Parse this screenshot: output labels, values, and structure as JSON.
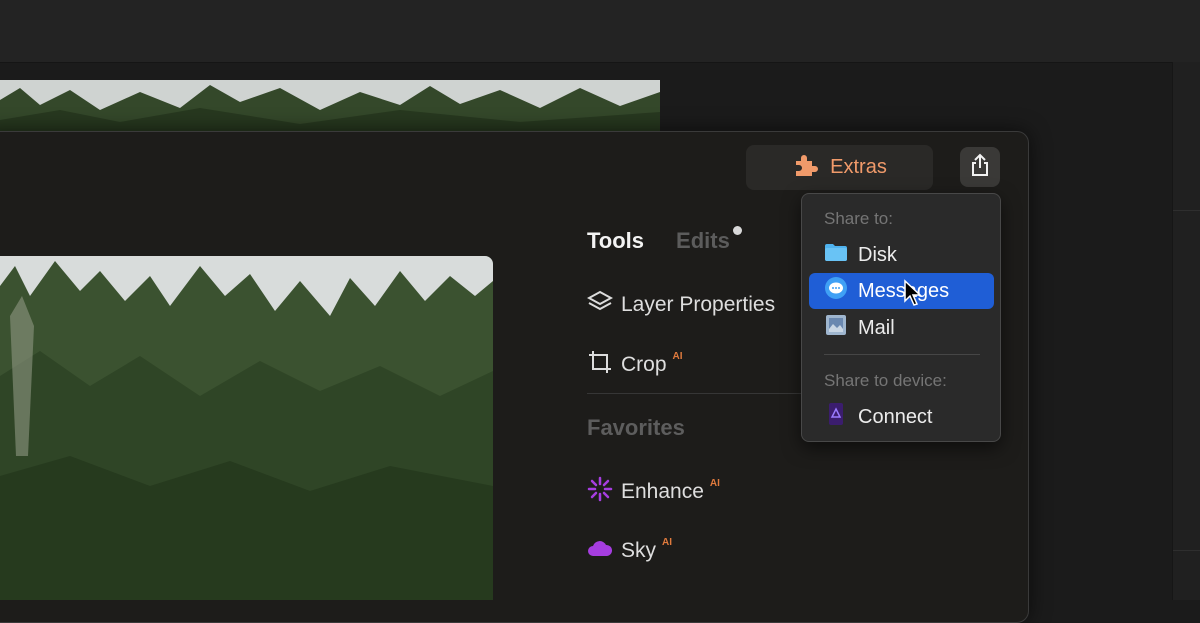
{
  "toolbar": {
    "extras_label": "Extras",
    "extras_icon": "puzzle-piece-icon",
    "share_icon": "share-icon"
  },
  "tabs": [
    {
      "label": "Tools",
      "active": true
    },
    {
      "label": "Edits",
      "active": false,
      "has_badge_dot": true
    }
  ],
  "tools": [
    {
      "label": "Layer Properties",
      "icon": "layers-icon",
      "ai": ""
    },
    {
      "label": "Crop",
      "icon": "crop-icon",
      "ai": "AI"
    }
  ],
  "favorites": {
    "title": "Favorites",
    "items": [
      {
        "label": "Enhance",
        "icon": "sparkle-icon",
        "ai": "AI"
      },
      {
        "label": "Sky",
        "icon": "cloud-icon",
        "ai": "AI"
      }
    ]
  },
  "share_menu": {
    "share_to_header": "Share to:",
    "share_to_items": [
      {
        "label": "Disk",
        "icon": "folder-icon",
        "highlighted": false
      },
      {
        "label": "Messages",
        "icon": "messages-icon",
        "highlighted": true
      },
      {
        "label": "Mail",
        "icon": "mail-icon",
        "highlighted": false
      }
    ],
    "device_header": "Share to device:",
    "device_items": [
      {
        "label": "Connect",
        "icon": "connect-app-icon",
        "highlighted": false
      }
    ]
  },
  "colors": {
    "accent_orange": "#f09a6a",
    "highlight_blue": "#1f5ed6",
    "ai_badge": "#e07a3d",
    "favorites_purple": "#a63de0"
  }
}
